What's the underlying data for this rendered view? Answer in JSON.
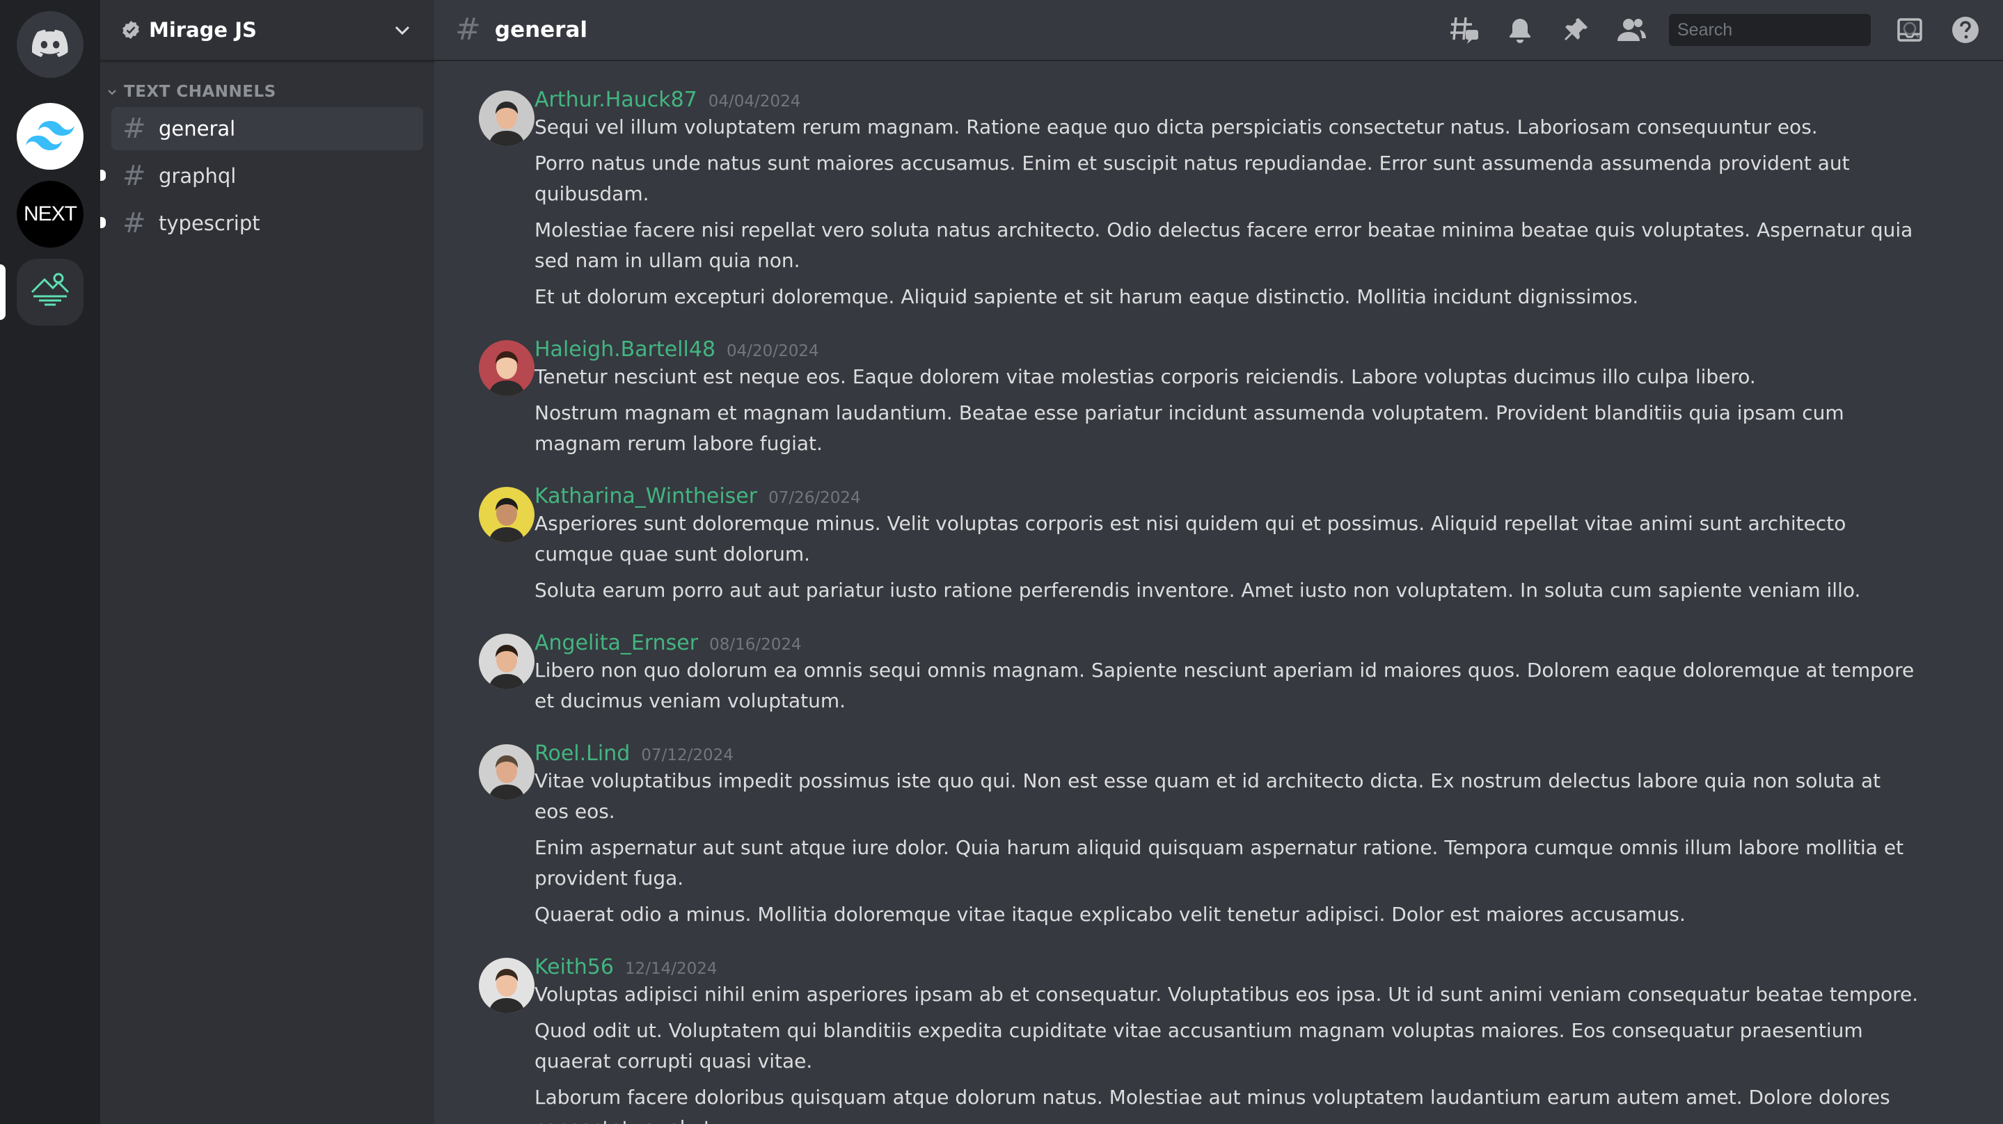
{
  "server_rail": {
    "servers": [
      {
        "name": "home",
        "icon": "discord-logo-icon"
      },
      {
        "name": "tailwind",
        "icon": "tailwind-logo-icon"
      },
      {
        "name": "next",
        "icon": "nextjs-logo-icon",
        "label": "NEXT"
      },
      {
        "name": "mirage",
        "icon": "mirage-logo-icon",
        "active": true
      }
    ]
  },
  "sidebar": {
    "guild_name": "Mirage JS",
    "category": "TEXT CHANNELS",
    "channels": [
      {
        "label": "general",
        "active": true,
        "unread": false
      },
      {
        "label": "graphql",
        "active": false,
        "unread": true
      },
      {
        "label": "typescript",
        "active": false,
        "unread": true
      }
    ]
  },
  "topbar": {
    "channel_title": "general",
    "search_placeholder": "Search"
  },
  "colors": {
    "author": "#43b581",
    "background": "#36393f",
    "sidebar": "#2f3136",
    "rail": "#202225"
  },
  "messages": [
    {
      "author": "Arthur.Hauck87",
      "timestamp": "04/04/2024",
      "lines": [
        "Sequi vel illum voluptatem rerum magnam. Ratione eaque quo dicta perspiciatis consectetur natus. Laboriosam consequuntur eos.",
        "Porro natus unde natus sunt maiores accusamus. Enim et suscipit natus repudiandae. Error sunt assumenda assumenda provident aut quibusdam.",
        "Molestiae facere nisi repellat vero soluta natus architecto. Odio delectus facere error beatae minima beatae quis voluptates. Aspernatur quia sed nam in ullam quia non.",
        "Et ut dolorum excepturi doloremque. Aliquid sapiente et sit harum eaque distinctio. Mollitia incidunt dignissimos."
      ]
    },
    {
      "author": "Haleigh.Bartell48",
      "timestamp": "04/20/2024",
      "lines": [
        "Tenetur nesciunt est neque eos. Eaque dolorem vitae molestias corporis reiciendis. Labore voluptas ducimus illo culpa libero.",
        "Nostrum magnam et magnam laudantium. Beatae esse pariatur incidunt assumenda voluptatem. Provident blanditiis quia ipsam cum magnam rerum labore fugiat."
      ]
    },
    {
      "author": "Katharina_Wintheiser",
      "timestamp": "07/26/2024",
      "lines": [
        "Asperiores sunt doloremque minus. Velit voluptas corporis est nisi quidem qui et possimus. Aliquid repellat vitae animi sunt architecto cumque quae sunt dolorum.",
        "Soluta earum porro aut aut pariatur iusto ratione perferendis inventore. Amet iusto non voluptatem. In soluta cum sapiente veniam illo."
      ]
    },
    {
      "author": "Angelita_Ernser",
      "timestamp": "08/16/2024",
      "lines": [
        "Libero non quo dolorum ea omnis sequi omnis magnam. Sapiente nesciunt aperiam id maiores quos. Dolorem eaque doloremque at tempore et ducimus veniam voluptatum."
      ]
    },
    {
      "author": "Roel.Lind",
      "timestamp": "07/12/2024",
      "lines": [
        "Vitae voluptatibus impedit possimus iste quo qui. Non est esse quam et id architecto dicta. Ex nostrum delectus labore quia non soluta at eos eos.",
        "Enim aspernatur aut sunt atque iure dolor. Quia harum aliquid quisquam aspernatur ratione. Tempora cumque omnis illum labore mollitia et provident fuga.",
        "Quaerat odio a minus. Mollitia doloremque vitae itaque explicabo velit tenetur adipisci. Dolor est maiores accusamus."
      ]
    },
    {
      "author": "Keith56",
      "timestamp": "12/14/2024",
      "lines": [
        "Voluptas adipisci nihil enim asperiores ipsam ab et consequatur. Voluptatibus eos ipsa. Ut id sunt animi veniam consequatur beatae tempore.",
        "Quod odit ut. Voluptatem qui blanditiis expedita cupiditate vitae accusantium magnam voluptas maiores. Eos consequatur praesentium quaerat corrupti quasi vitae.",
        "Laborum facere doloribus quisquam atque dolorum natus. Molestiae aut minus voluptatem laudantium earum autem amet. Dolore dolores consectetur vel ut."
      ]
    }
  ]
}
